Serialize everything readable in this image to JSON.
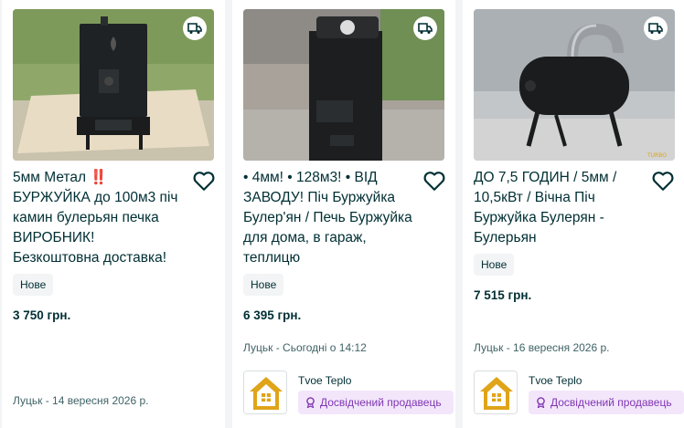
{
  "listings": [
    {
      "title": "5мм Метал ‼️ БУРЖУЙКА до 100м3 піч камин булерьян печка ВИРОБНИК! Безкоштовна доставка!",
      "badge": "Нове",
      "price": "3 750 грн.",
      "location_date": "Луцьк - 14 вересня 2026 р.",
      "icons": [
        "delivery-truck-icon",
        "heart-icon"
      ]
    },
    {
      "title": "• 4мм! • 128м3! • ВІД ЗАВОДУ! Піч Буржуйка Булер'ян / Печь Буржуйка для дома, в гараж, теплицю",
      "badge": "Нове",
      "price": "6 395 грн.",
      "location_date": "Луцьк - Сьогодні о 14:12",
      "seller": {
        "name": "Tvoe Teplo",
        "tag": "Досвідчений продавець"
      },
      "icons": [
        "delivery-truck-icon",
        "heart-icon"
      ]
    },
    {
      "title": "ДО 7,5 ГОДИН / 5мм / 10,5кВт / Вічна Піч Буржуйка Булерян - Булерьян",
      "badge": "Нове",
      "price": "7 515 грн.",
      "location_date": "Луцьк - 16 вересня 2026 р.",
      "seller": {
        "name": "Tvoe Teplo",
        "tag": "Досвідчений продавець"
      },
      "icons": [
        "delivery-truck-icon",
        "heart-icon"
      ]
    }
  ],
  "colors": {
    "text": "#002f34",
    "muted": "#406367",
    "seller_tag_bg": "#f3e6fb",
    "seller_tag_text": "#7f35b2",
    "logo_gold": "#e0a419"
  }
}
